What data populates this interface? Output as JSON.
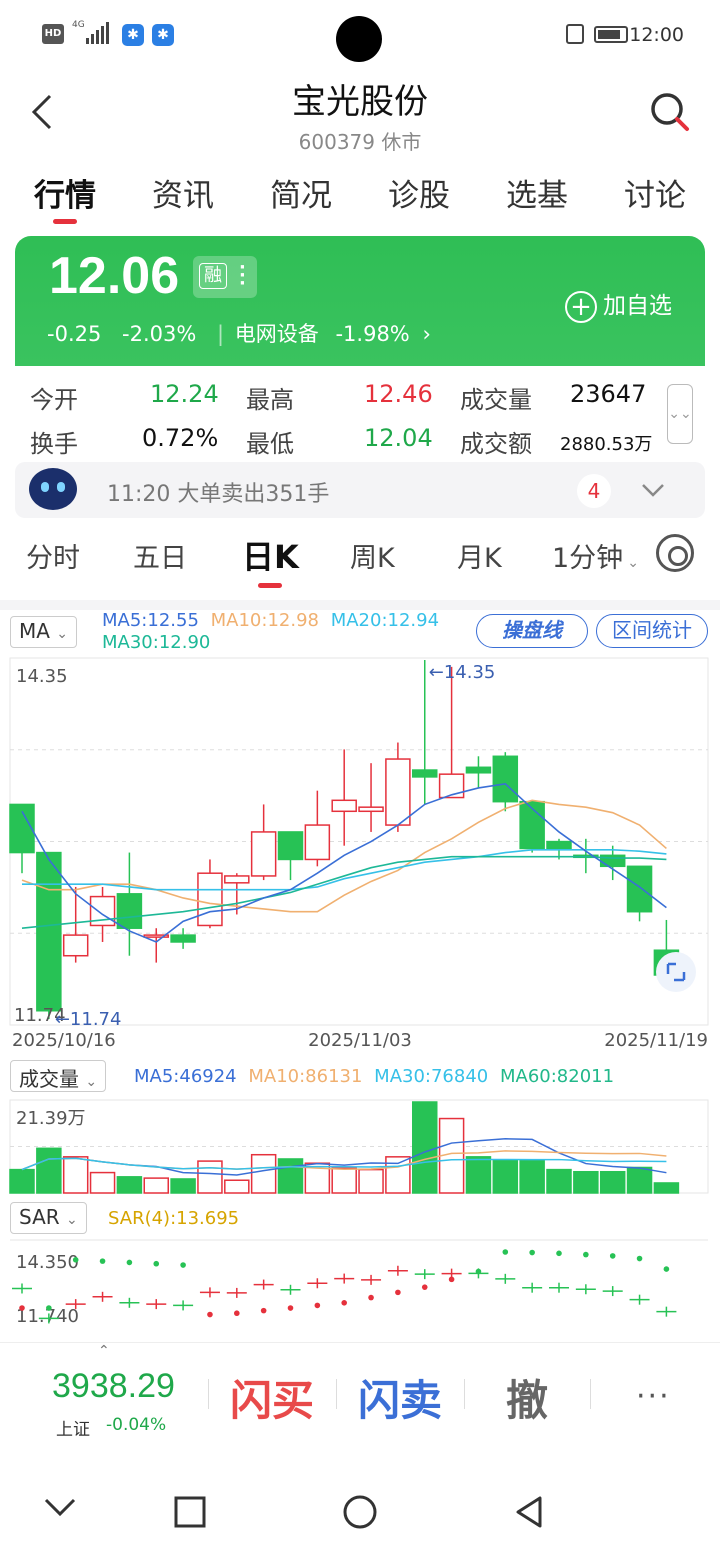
{
  "status": {
    "time": "12:00",
    "network": "4G",
    "hd": "HD"
  },
  "header": {
    "title": "宝光股份",
    "subtitle": "600379 休市"
  },
  "tabs": [
    "行情",
    "资讯",
    "简况",
    "诊股",
    "选基",
    "讨论"
  ],
  "quote": {
    "price": "12.06",
    "rong": "融",
    "change": "-0.25",
    "change_pct": "-2.03%",
    "sector": "电网设备",
    "sector_pct": "-1.98%",
    "add_label": "加自选"
  },
  "stats": {
    "open_label": "今开",
    "open": "12.24",
    "high_label": "最高",
    "high": "12.46",
    "volume_label": "成交量",
    "volume": "23647",
    "turnover_label": "换手",
    "turnover": "0.72%",
    "low_label": "最低",
    "low": "12.04",
    "amount_label": "成交额",
    "amount": "2880.53万"
  },
  "notice": {
    "text": "11:20 大单卖出351手",
    "count": "4"
  },
  "period_tabs": [
    "分时",
    "五日",
    "日K",
    "周K",
    "月K",
    "1分钟"
  ],
  "colors": {
    "up": "#e5313c",
    "down": "#27c255",
    "ma5": "#3a6fd6",
    "ma10": "#f0b070",
    "ma20": "#36c0e8",
    "ma30": "#1db897",
    "ma60": "#22b88a",
    "sar": "#d6a400"
  },
  "chart_data": {
    "type": "candlestick",
    "indicator_select": "MA",
    "ma_legend": [
      "MA5:12.55",
      "MA10:12.98",
      "MA20:12.94",
      "MA30:12.90"
    ],
    "btn_caopan": "操盘线",
    "btn_interval": "区间统计",
    "y_max_label": "14.35",
    "y_min_label": "11.74",
    "high_mark": "←14.35",
    "low_mark": "←11.74",
    "dates": [
      "2025/10/16",
      "2025/11/03",
      "2025/11/19"
    ],
    "y_range": [
      11.74,
      14.35
    ],
    "candles": [
      {
        "o": 13.3,
        "h": 13.3,
        "l": 12.8,
        "c": 12.95
      },
      {
        "o": 12.95,
        "h": 12.95,
        "l": 11.74,
        "c": 11.8
      },
      {
        "o": 12.2,
        "h": 12.7,
        "l": 12.15,
        "c": 12.35
      },
      {
        "o": 12.42,
        "h": 12.7,
        "l": 12.3,
        "c": 12.63
      },
      {
        "o": 12.65,
        "h": 12.95,
        "l": 12.2,
        "c": 12.4
      },
      {
        "o": 12.35,
        "h": 12.4,
        "l": 12.15,
        "c": 12.35
      },
      {
        "o": 12.35,
        "h": 12.4,
        "l": 12.25,
        "c": 12.3
      },
      {
        "o": 12.42,
        "h": 12.9,
        "l": 12.4,
        "c": 12.8
      },
      {
        "o": 12.73,
        "h": 12.8,
        "l": 12.5,
        "c": 12.78
      },
      {
        "o": 12.78,
        "h": 13.3,
        "l": 12.75,
        "c": 13.1
      },
      {
        "o": 13.1,
        "h": 13.1,
        "l": 12.75,
        "c": 12.9
      },
      {
        "o": 12.9,
        "h": 13.4,
        "l": 12.85,
        "c": 13.15
      },
      {
        "o": 13.25,
        "h": 13.7,
        "l": 13.0,
        "c": 13.33
      },
      {
        "o": 13.25,
        "h": 13.6,
        "l": 13.1,
        "c": 13.28
      },
      {
        "o": 13.15,
        "h": 13.75,
        "l": 13.1,
        "c": 13.63
      },
      {
        "o": 13.55,
        "h": 14.35,
        "l": 13.3,
        "c": 13.5
      },
      {
        "o": 13.35,
        "h": 14.3,
        "l": 13.35,
        "c": 13.52
      },
      {
        "o": 13.57,
        "h": 13.65,
        "l": 13.42,
        "c": 13.53
      },
      {
        "o": 13.65,
        "h": 13.68,
        "l": 13.25,
        "c": 13.32
      },
      {
        "o": 13.32,
        "h": 13.32,
        "l": 12.95,
        "c": 12.98
      },
      {
        "o": 13.03,
        "h": 13.05,
        "l": 12.9,
        "c": 12.98
      },
      {
        "o": 12.93,
        "h": 13.05,
        "l": 12.8,
        "c": 12.92
      },
      {
        "o": 12.93,
        "h": 13.0,
        "l": 12.75,
        "c": 12.85
      },
      {
        "o": 12.85,
        "h": 12.85,
        "l": 12.45,
        "c": 12.52
      },
      {
        "o": 12.24,
        "h": 12.46,
        "l": 12.04,
        "c": 12.06
      }
    ],
    "ma5_line": [
      13.25,
      12.9,
      12.65,
      12.5,
      12.38,
      12.3,
      12.45,
      12.52,
      12.54,
      12.62,
      12.68,
      12.8,
      12.93,
      13.03,
      13.15,
      13.3,
      13.37,
      13.42,
      13.45,
      13.27,
      13.1,
      12.96,
      12.83,
      12.7,
      12.55
    ],
    "ma10_line": [
      12.75,
      12.68,
      12.68,
      12.72,
      12.72,
      12.68,
      12.62,
      12.58,
      12.56,
      12.54,
      12.52,
      12.52,
      12.64,
      12.74,
      12.82,
      12.95,
      13.05,
      13.17,
      13.27,
      13.33,
      13.3,
      13.28,
      13.24,
      13.15,
      12.98
    ],
    "ma20_line": [
      12.72,
      12.72,
      12.72,
      12.72,
      12.7,
      12.68,
      12.68,
      12.68,
      12.68,
      12.68,
      12.68,
      12.7,
      12.76,
      12.8,
      12.84,
      12.88,
      12.9,
      12.92,
      12.95,
      12.97,
      12.97,
      12.97,
      12.97,
      12.96,
      12.94
    ],
    "ma30_line": [
      12.4,
      12.42,
      12.44,
      12.46,
      12.48,
      12.5,
      12.52,
      12.55,
      12.58,
      12.62,
      12.66,
      12.72,
      12.78,
      12.84,
      12.88,
      12.9,
      12.92,
      12.92,
      12.92,
      12.92,
      12.92,
      12.92,
      12.91,
      12.91,
      12.9
    ],
    "volume_select": "成交量",
    "volume_legend": [
      "MA5:46924",
      "MA10:86131",
      "MA30:76840",
      "MA60:82011"
    ],
    "volume_max_label": "21.39万",
    "volumes": [
      5.5,
      10.5,
      8.5,
      4.8,
      3.8,
      3.5,
      3.3,
      7.5,
      3.0,
      9.0,
      8.0,
      7.0,
      5.8,
      5.5,
      8.5,
      21.39,
      17.5,
      8.5,
      7.8,
      7.8,
      5.5,
      5.0,
      5.0,
      6.0,
      2.36
    ],
    "sar_select": "SAR",
    "sar_legend": "SAR(4):13.695",
    "sar_max_label": "14.350",
    "sar_min_label": "11.740",
    "sar": [
      12.2,
      12.2,
      14.05,
      14.0,
      13.95,
      13.9,
      13.85,
      11.95,
      12.0,
      12.1,
      12.2,
      12.3,
      12.4,
      12.6,
      12.8,
      13.0,
      13.3,
      13.6,
      14.35,
      14.33,
      14.3,
      14.25,
      14.2,
      14.1,
      13.695
    ],
    "sar_closes": [
      12.95,
      11.8,
      12.35,
      12.63,
      12.4,
      12.35,
      12.3,
      12.8,
      12.78,
      13.1,
      12.9,
      13.15,
      13.33,
      13.28,
      13.63,
      13.5,
      13.52,
      13.53,
      13.32,
      12.98,
      12.98,
      12.92,
      12.85,
      12.52,
      12.06
    ]
  },
  "bottom": {
    "index_value": "3938.29",
    "index_name": "上证",
    "index_pct": "-0.04%",
    "buy": "闪买",
    "sell": "闪卖",
    "cancel": "撤",
    "more": "···"
  }
}
